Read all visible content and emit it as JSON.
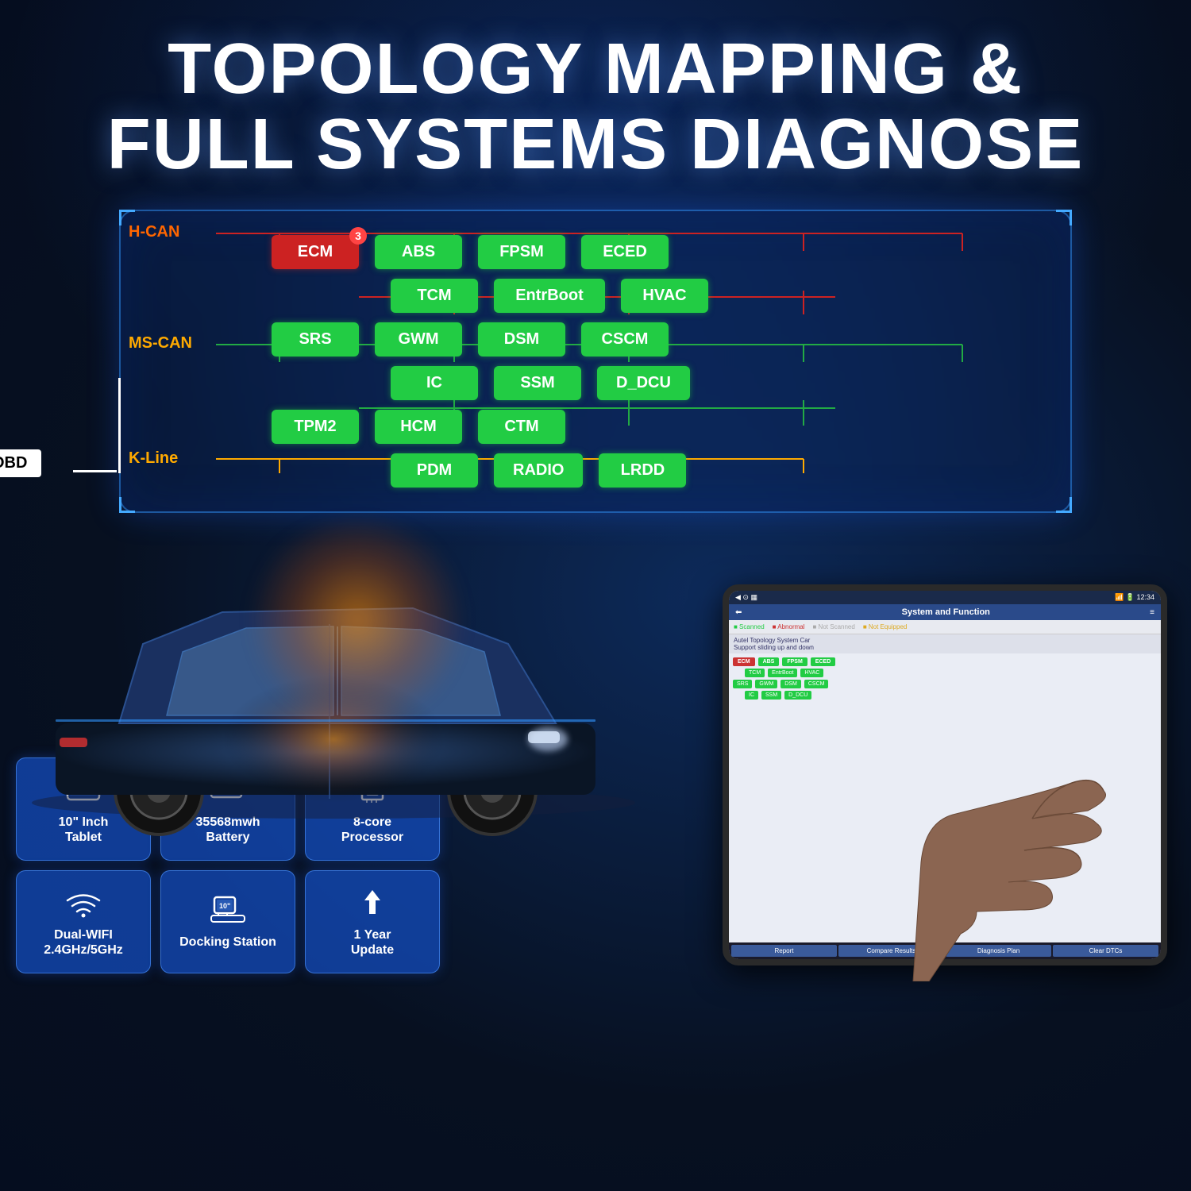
{
  "title": {
    "line1": "TOPOLOGY MAPPING &",
    "line2": "FULL SYSTEMS DIAGNOSE"
  },
  "topology": {
    "bus_labels": {
      "hcan": "H-CAN",
      "mscan": "MS-CAN",
      "kline": "K-Line"
    },
    "obd_label": "OBD",
    "rows": {
      "row1": [
        "ECM",
        "ABS",
        "FPSM",
        "ECED"
      ],
      "row2": [
        "TCM",
        "EntrBoot",
        "HVAC"
      ],
      "row3": [
        "SRS",
        "GWM",
        "DSM",
        "CSCM"
      ],
      "row4": [
        "IC",
        "SSM",
        "D_DCU"
      ],
      "row5": [
        "TPM2",
        "HCM",
        "CTM"
      ],
      "row6": [
        "PDM",
        "RADIO",
        "LRDD"
      ]
    },
    "ecm_badge": "3"
  },
  "features": [
    {
      "icon": "tablet",
      "label": "10\" Inch\nTablet",
      "id": "tablet"
    },
    {
      "icon": "battery",
      "label": "35568mwh\nBattery",
      "id": "battery"
    },
    {
      "icon": "processor",
      "label": "8-core\nProcessor",
      "id": "processor"
    },
    {
      "icon": "wifi",
      "label": "Dual-WIFI\n2.4GHz/5GHz",
      "id": "wifi"
    },
    {
      "icon": "docking",
      "label": "Docking Station",
      "id": "docking"
    },
    {
      "icon": "update",
      "label": "1 Year\nUpdate",
      "id": "update"
    }
  ],
  "tablet": {
    "header_title": "System and Function",
    "status_labels": [
      "Scanned",
      "Abnormal",
      "Not Scanned",
      "Not Equipped"
    ],
    "subtitle": "Autel Topology System Car",
    "support_text": "Support sliding up and down",
    "footer_buttons": [
      "Report",
      "Compare Results",
      "Diagnosis Plan",
      "Clear DTCs"
    ]
  },
  "colors": {
    "accent_blue": "#1a5cd4",
    "node_green": "#22cc44",
    "node_red": "#cc2222",
    "bus_orange": "#ffaa00",
    "bus_red": "#ff6600",
    "background": "#071020"
  }
}
